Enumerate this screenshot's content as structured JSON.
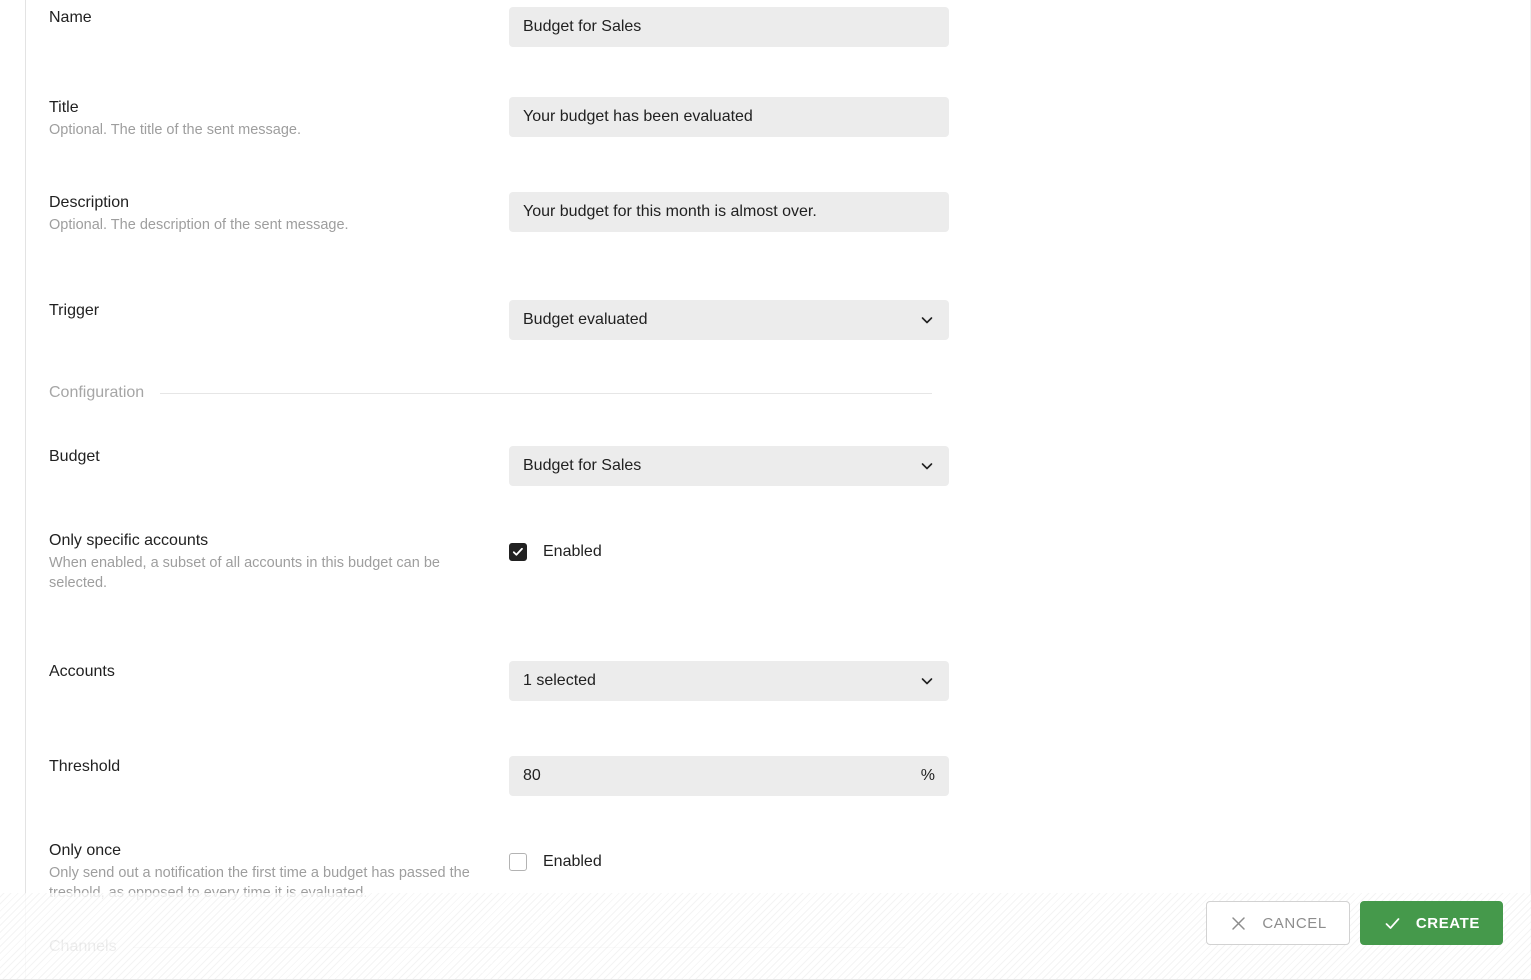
{
  "form": {
    "fields": {
      "name": {
        "label": "Name",
        "value": "Budget for Sales"
      },
      "title": {
        "label": "Title",
        "hint": "Optional. The title of the sent message.",
        "value": "Your budget has been evaluated"
      },
      "description": {
        "label": "Description",
        "hint": "Optional. The description of the sent message.",
        "value": "Your budget for this month is almost over."
      },
      "trigger": {
        "label": "Trigger",
        "value": "Budget evaluated",
        "icon": "chevron-down-icon"
      },
      "budget": {
        "label": "Budget",
        "value": "Budget for Sales",
        "icon": "chevron-down-icon"
      },
      "only_specific_accounts": {
        "label": "Only specific accounts",
        "hint": "When enabled, a subset of all accounts in this budget can be selected.",
        "checkbox_label": "Enabled",
        "checked": true
      },
      "accounts": {
        "label": "Accounts",
        "value": "1 selected",
        "icon": "chevron-down-icon"
      },
      "threshold": {
        "label": "Threshold",
        "value": "80",
        "suffix": "%"
      },
      "only_once": {
        "label": "Only once",
        "hint": "Only send out a notification the first time a budget has passed the treshold, as opposed to every time it is evaluated.",
        "checkbox_label": "Enabled",
        "checked": false
      }
    },
    "sections": {
      "configuration": "Configuration",
      "channels": "Channels"
    }
  },
  "actions": {
    "cancel": {
      "label": "CANCEL",
      "icon": "close-icon"
    },
    "create": {
      "label": "CREATE",
      "icon": "check-icon"
    }
  },
  "colors": {
    "accent_green": "#45994b",
    "field_background": "#ececec",
    "text_primary": "#212121",
    "text_muted": "#9e9e9e"
  }
}
